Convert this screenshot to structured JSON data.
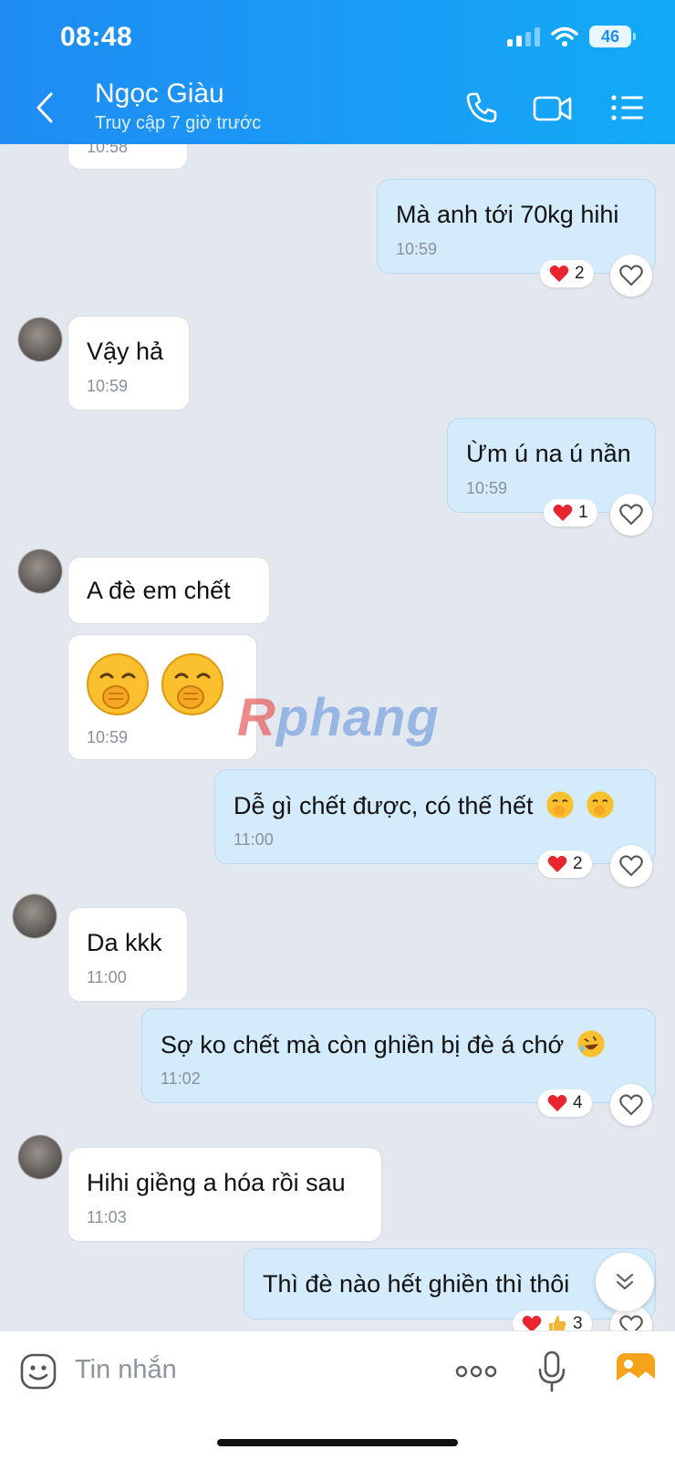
{
  "status_bar": {
    "time": "08:48",
    "battery": "46"
  },
  "header": {
    "contact_name": "Ngọc Giàu",
    "last_seen": "Truy cập 7 giờ trước"
  },
  "watermark": {
    "prefix": "R",
    "rest": "phang"
  },
  "messages": [
    {
      "time": "10:58"
    },
    {
      "text": "Mà anh tới 70kg hihi",
      "time": "10:59",
      "reaction_count": "2"
    },
    {
      "text": "Vậy hả",
      "time": "10:59"
    },
    {
      "text": "Ừm ú na ú nần",
      "time": "10:59",
      "reaction_count": "1"
    },
    {
      "text": "A đè em chết"
    },
    {
      "time": "10:59"
    },
    {
      "text": "Dễ gì chết được, có thế hết",
      "time": "11:00",
      "reaction_count": "2"
    },
    {
      "text": "Da kkk",
      "time": "11:00"
    },
    {
      "text": "Sợ ko chết mà còn ghiền bị đè á chớ",
      "time": "11:02",
      "reaction_count": "4"
    },
    {
      "text": "Hihi giềng a hóa rồi sau",
      "time": "11:03"
    },
    {
      "text": "Thì đè nào hết ghiền thì thôi",
      "reaction_count": "3"
    }
  ],
  "input": {
    "placeholder": "Tin nhắn"
  },
  "icons": {
    "back": "chevron-left-icon",
    "call": "phone-icon",
    "video": "video-icon",
    "menu": "list-menu-icon",
    "sticker": "sticker-face-icon",
    "more": "more-dots-icon",
    "mic": "microphone-icon",
    "image": "image-gallery-icon"
  },
  "colors": {
    "header_start": "#1e8cf3",
    "header_end": "#12aaf7",
    "outgoing_bubble": "#d4ebfb",
    "incoming_bubble": "#ffffff",
    "chat_bg": "#e3e8ee"
  }
}
